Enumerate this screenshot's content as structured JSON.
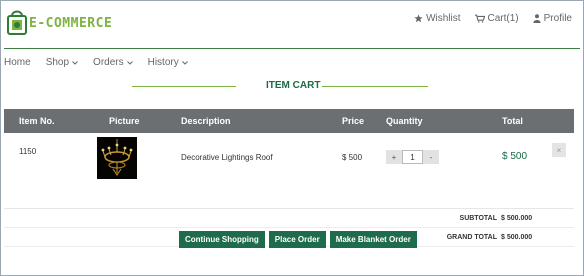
{
  "brand": {
    "name": "E-COMMERCE",
    "color": "#7cb342"
  },
  "top_links": [
    {
      "label": "Wishlist",
      "icon": "star-icon"
    },
    {
      "label": "Cart(1)",
      "icon": "cart-icon"
    },
    {
      "label": "Profile",
      "icon": "user-icon"
    }
  ],
  "nav": [
    {
      "label": "Home",
      "has_dropdown": false
    },
    {
      "label": "Shop",
      "has_dropdown": true
    },
    {
      "label": "Orders",
      "has_dropdown": true
    },
    {
      "label": "History",
      "has_dropdown": true
    }
  ],
  "section_title": "ITEM CART",
  "table": {
    "headers": [
      "Item No.",
      "Picture",
      "Description",
      "Price",
      "Quantity",
      "Total"
    ],
    "rows": [
      {
        "item_no": "1150",
        "picture_icon": "chandelier-image",
        "description": "Decorative Lightings Roof",
        "price": "$ 500",
        "qty_minus": "+",
        "quantity": "1",
        "qty_plus": "-",
        "total": "$ 500",
        "remove_icon": "close-icon"
      }
    ]
  },
  "summary": {
    "subtotal_label": "SUBTOTAL",
    "subtotal_value": "$ 500.000",
    "grand_total_label": "GRAND TOTAL",
    "grand_total_value": "$ 500.000"
  },
  "actions": {
    "continue_label": "Continue Shopping",
    "place_order_label": "Place Order",
    "blanket_order_label": "Make Blanket Order"
  },
  "colors": {
    "accent": "#1e6b4d",
    "header_rule": "#3a7d44",
    "table_header": "#6b6f72"
  }
}
